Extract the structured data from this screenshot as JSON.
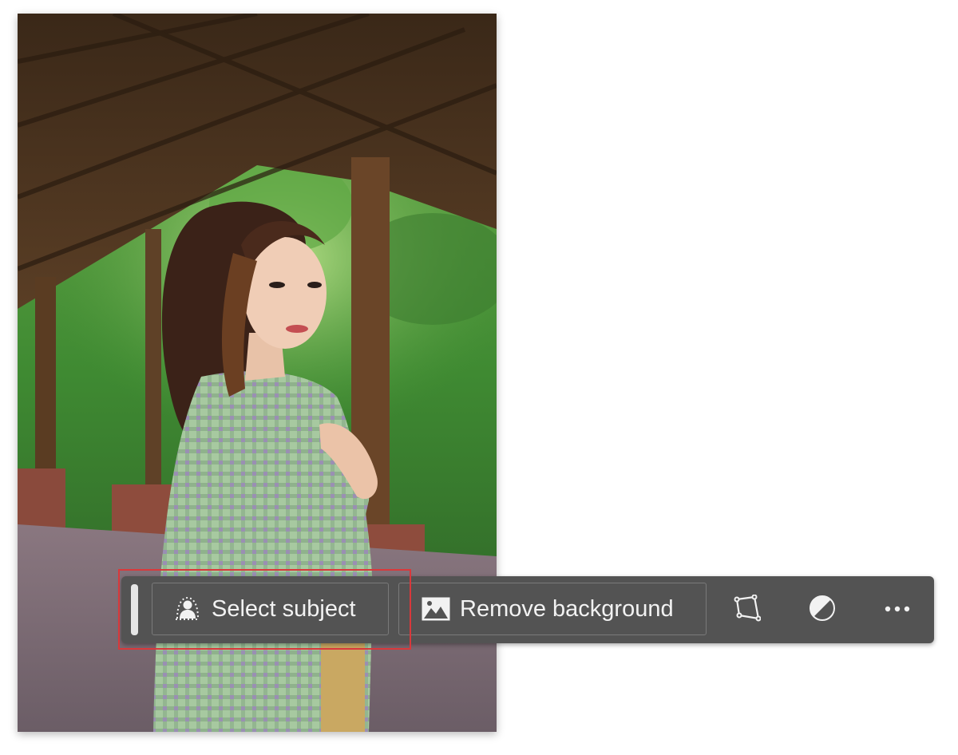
{
  "canvas": {
    "image_alt": "Photo of a young woman with long brown hair in a green gingham shirt standing under a wooden pavilion with green foliage behind"
  },
  "taskbar": {
    "select_subject_label": "Select subject",
    "remove_background_label": "Remove background",
    "icons": {
      "select_subject": "person-selection-icon",
      "remove_background": "image-landscape-icon",
      "transform": "transform-polygon-icon",
      "adjust": "half-circle-adjust-icon",
      "more": "more-dots-icon"
    },
    "colors": {
      "bar_background": "#535353",
      "button_border": "#7a7a7a",
      "text": "#f2f2f2",
      "highlight": "#d9383b"
    }
  }
}
